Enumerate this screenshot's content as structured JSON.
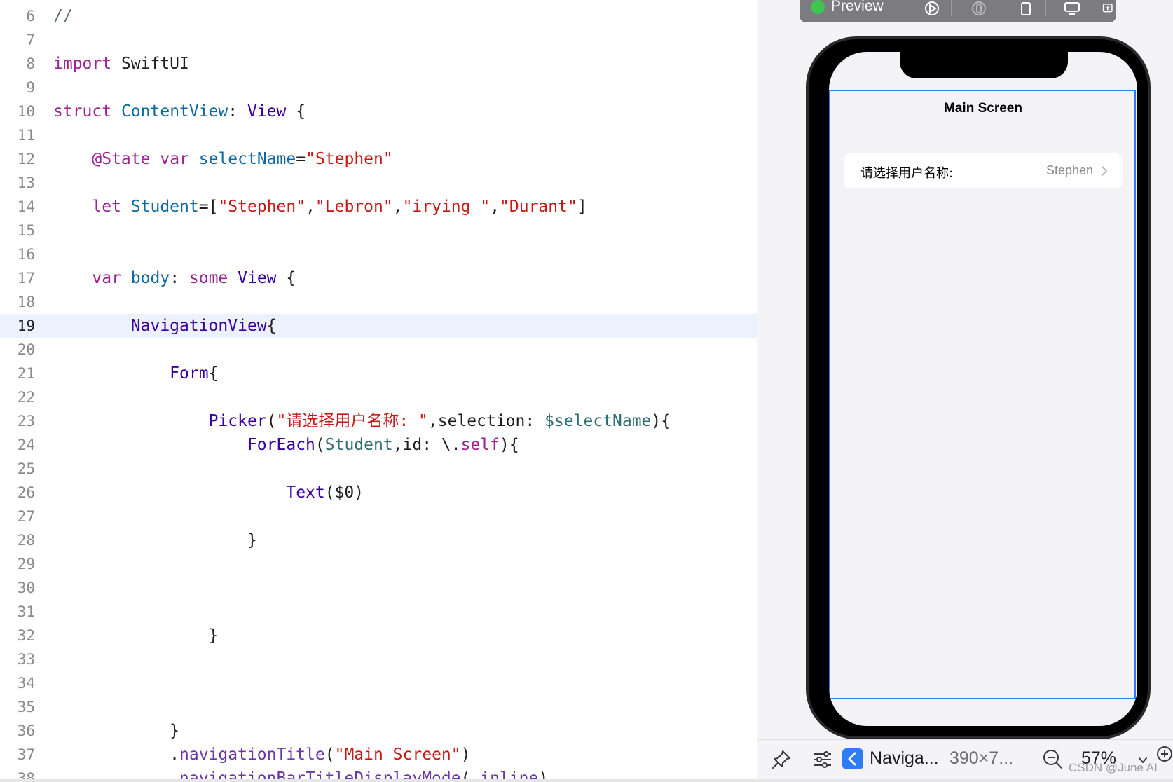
{
  "editor": {
    "current_line": "19",
    "lines": [
      {
        "n": "6",
        "tokens": [
          {
            "t": "//",
            "c": "cm"
          }
        ]
      },
      {
        "n": "7",
        "tokens": []
      },
      {
        "n": "8",
        "tokens": [
          {
            "t": "import",
            "c": "kw"
          },
          {
            "t": " SwiftUI",
            "c": "plain"
          }
        ]
      },
      {
        "n": "9",
        "tokens": []
      },
      {
        "n": "10",
        "tokens": [
          {
            "t": "struct",
            "c": "kw"
          },
          {
            "t": " ",
            "c": "plain"
          },
          {
            "t": "ContentView",
            "c": "decl"
          },
          {
            "t": ": ",
            "c": "plain"
          },
          {
            "t": "View",
            "c": "type"
          },
          {
            "t": " {",
            "c": "plain"
          }
        ]
      },
      {
        "n": "11",
        "tokens": []
      },
      {
        "n": "12",
        "tokens": [
          {
            "t": "    ",
            "c": "plain"
          },
          {
            "t": "@State",
            "c": "kw"
          },
          {
            "t": " ",
            "c": "plain"
          },
          {
            "t": "var",
            "c": "kw"
          },
          {
            "t": " ",
            "c": "plain"
          },
          {
            "t": "selectName",
            "c": "decl"
          },
          {
            "t": "=",
            "c": "plain"
          },
          {
            "t": "\"Stephen\"",
            "c": "str"
          }
        ]
      },
      {
        "n": "13",
        "tokens": []
      },
      {
        "n": "14",
        "tokens": [
          {
            "t": "    ",
            "c": "plain"
          },
          {
            "t": "let",
            "c": "kw"
          },
          {
            "t": " ",
            "c": "plain"
          },
          {
            "t": "Student",
            "c": "decl"
          },
          {
            "t": "=[",
            "c": "plain"
          },
          {
            "t": "\"Stephen\"",
            "c": "str"
          },
          {
            "t": ",",
            "c": "plain"
          },
          {
            "t": "\"Lebron\"",
            "c": "str"
          },
          {
            "t": ",",
            "c": "plain"
          },
          {
            "t": "\"irying \"",
            "c": "str"
          },
          {
            "t": ",",
            "c": "plain"
          },
          {
            "t": "\"Durant\"",
            "c": "str"
          },
          {
            "t": "]",
            "c": "plain"
          }
        ]
      },
      {
        "n": "15",
        "tokens": []
      },
      {
        "n": "16",
        "tokens": []
      },
      {
        "n": "17",
        "tokens": [
          {
            "t": "    ",
            "c": "plain"
          },
          {
            "t": "var",
            "c": "kw"
          },
          {
            "t": " ",
            "c": "plain"
          },
          {
            "t": "body",
            "c": "decl"
          },
          {
            "t": ": ",
            "c": "plain"
          },
          {
            "t": "some",
            "c": "kw"
          },
          {
            "t": " ",
            "c": "plain"
          },
          {
            "t": "View",
            "c": "type"
          },
          {
            "t": " {",
            "c": "plain"
          }
        ]
      },
      {
        "n": "18",
        "tokens": []
      },
      {
        "n": "19",
        "tokens": [
          {
            "t": "        ",
            "c": "plain"
          },
          {
            "t": "NavigationView",
            "c": "type"
          },
          {
            "t": "{",
            "c": "plain"
          }
        ]
      },
      {
        "n": "20",
        "tokens": []
      },
      {
        "n": "21",
        "tokens": [
          {
            "t": "            ",
            "c": "plain"
          },
          {
            "t": "Form",
            "c": "type"
          },
          {
            "t": "{",
            "c": "plain"
          }
        ]
      },
      {
        "n": "22",
        "tokens": []
      },
      {
        "n": "23",
        "tokens": [
          {
            "t": "                ",
            "c": "plain"
          },
          {
            "t": "Picker",
            "c": "type"
          },
          {
            "t": "(",
            "c": "plain"
          },
          {
            "t": "\"请选择用户名称: \"",
            "c": "str"
          },
          {
            "t": ",selection: ",
            "c": "plain"
          },
          {
            "t": "$selectName",
            "c": "prop"
          },
          {
            "t": "){",
            "c": "plain"
          }
        ]
      },
      {
        "n": "24",
        "tokens": [
          {
            "t": "                    ",
            "c": "plain"
          },
          {
            "t": "ForEach",
            "c": "type"
          },
          {
            "t": "(",
            "c": "plain"
          },
          {
            "t": "Student",
            "c": "prop"
          },
          {
            "t": ",id: \\.",
            "c": "plain"
          },
          {
            "t": "self",
            "c": "kw"
          },
          {
            "t": "){",
            "c": "plain"
          }
        ]
      },
      {
        "n": "25",
        "tokens": []
      },
      {
        "n": "26",
        "tokens": [
          {
            "t": "                        ",
            "c": "plain"
          },
          {
            "t": "Text",
            "c": "type"
          },
          {
            "t": "($0)",
            "c": "plain"
          }
        ]
      },
      {
        "n": "27",
        "tokens": []
      },
      {
        "n": "28",
        "tokens": [
          {
            "t": "                    }",
            "c": "plain"
          }
        ]
      },
      {
        "n": "29",
        "tokens": []
      },
      {
        "n": "30",
        "tokens": []
      },
      {
        "n": "31",
        "tokens": []
      },
      {
        "n": "32",
        "tokens": [
          {
            "t": "                }",
            "c": "plain"
          }
        ]
      },
      {
        "n": "33",
        "tokens": []
      },
      {
        "n": "34",
        "tokens": []
      },
      {
        "n": "35",
        "tokens": []
      },
      {
        "n": "36",
        "tokens": [
          {
            "t": "            }",
            "c": "plain"
          }
        ]
      },
      {
        "n": "37",
        "tokens": [
          {
            "t": "            .",
            "c": "plain"
          },
          {
            "t": "navigationTitle",
            "c": "fn"
          },
          {
            "t": "(",
            "c": "plain"
          },
          {
            "t": "\"Main Screen\"",
            "c": "str"
          },
          {
            "t": ")",
            "c": "plain"
          }
        ]
      },
      {
        "n": "38",
        "tokens": [
          {
            "t": "            .",
            "c": "plain"
          },
          {
            "t": "navigationBarTitleDisplayMode",
            "c": "fn"
          },
          {
            "t": "(.",
            "c": "plain"
          },
          {
            "t": "inline",
            "c": "fn"
          },
          {
            "t": ")",
            "c": "plain"
          }
        ]
      }
    ]
  },
  "preview": {
    "toolbar_label": "Preview",
    "toolbar_icons": [
      "live-preview-icon",
      "debug-icon",
      "device-icon",
      "device-settings-icon",
      "duplicate-preview-icon"
    ],
    "nav_title": "Main Screen",
    "picker_label": "请选择用户名称:",
    "picker_value": "Stephen"
  },
  "canvas_bar": {
    "nav_label": "Naviga...",
    "size_label": "390×7...",
    "zoom_label": "57%"
  },
  "watermark": "CSDN @June AI",
  "colors": {
    "keyword": "#9b2393",
    "string": "#c41a16",
    "type": "#3900a0",
    "declaration": "#0f68a0",
    "selection_frame": "#3478f6",
    "current_line": "#ecf2fd"
  }
}
